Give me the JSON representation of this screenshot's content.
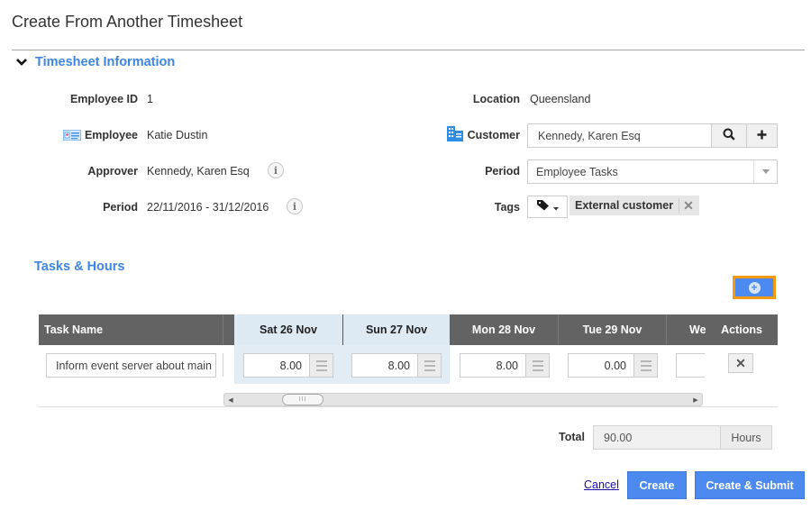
{
  "page": {
    "title": "Create From Another Timesheet"
  },
  "section_info": {
    "title": "Timesheet Information",
    "toggle_icon": "chevron-down-icon",
    "left_fields": [
      {
        "label": "Employee ID",
        "value": "1"
      },
      {
        "label": "Employee",
        "value": "Katie Dustin",
        "icon": "employee-card-icon"
      },
      {
        "label": "Approver",
        "value": "Kennedy, Karen Esq",
        "info_icon": true
      },
      {
        "label": "Period",
        "value": "22/11/2016 - 31/12/2016",
        "info_icon": true
      }
    ],
    "right_fields": {
      "location": {
        "label": "Location",
        "value": "Queensland"
      },
      "customer": {
        "label": "Customer",
        "value": "Kennedy, Karen Esq",
        "icon": "building-icon",
        "search_icon": "search-icon",
        "add_icon": "plus-icon"
      },
      "period": {
        "label": "Period",
        "selected": "Employee Tasks"
      },
      "tags": {
        "label": "Tags",
        "tag_icon": "tag-icon",
        "items": [
          "External customer"
        ]
      }
    }
  },
  "tasks": {
    "title": "Tasks & Hours",
    "add_row_icon": "plus-circle-icon",
    "columns": {
      "task_name": "Task Name",
      "days": [
        "Sat 26 Nov",
        "Sun 27 Nov",
        "Mon 28 Nov",
        "Tue 29 Nov",
        "We"
      ],
      "actions": "Actions"
    },
    "highlighted_days": [
      "Sat 26 Nov",
      "Sun 27 Nov"
    ],
    "rows": [
      {
        "task": "Inform event server about maintenance",
        "task_visible": "Inform event server about main",
        "hours": [
          "8.00",
          "8.00",
          "8.00",
          "0.00",
          ""
        ]
      }
    ],
    "scrollbar": {
      "thumb_glyph": "III"
    }
  },
  "total": {
    "label": "Total",
    "value": "90.00",
    "unit": "Hours"
  },
  "actions": {
    "cancel": "Cancel",
    "create": "Create",
    "create_submit": "Create & Submit"
  },
  "colors": {
    "accent": "#3d85e0",
    "primary_button": "#4d8af0",
    "focus_outline": "#f59a10",
    "table_header": "#636363",
    "weekend_highlight": "#dde9f3"
  }
}
